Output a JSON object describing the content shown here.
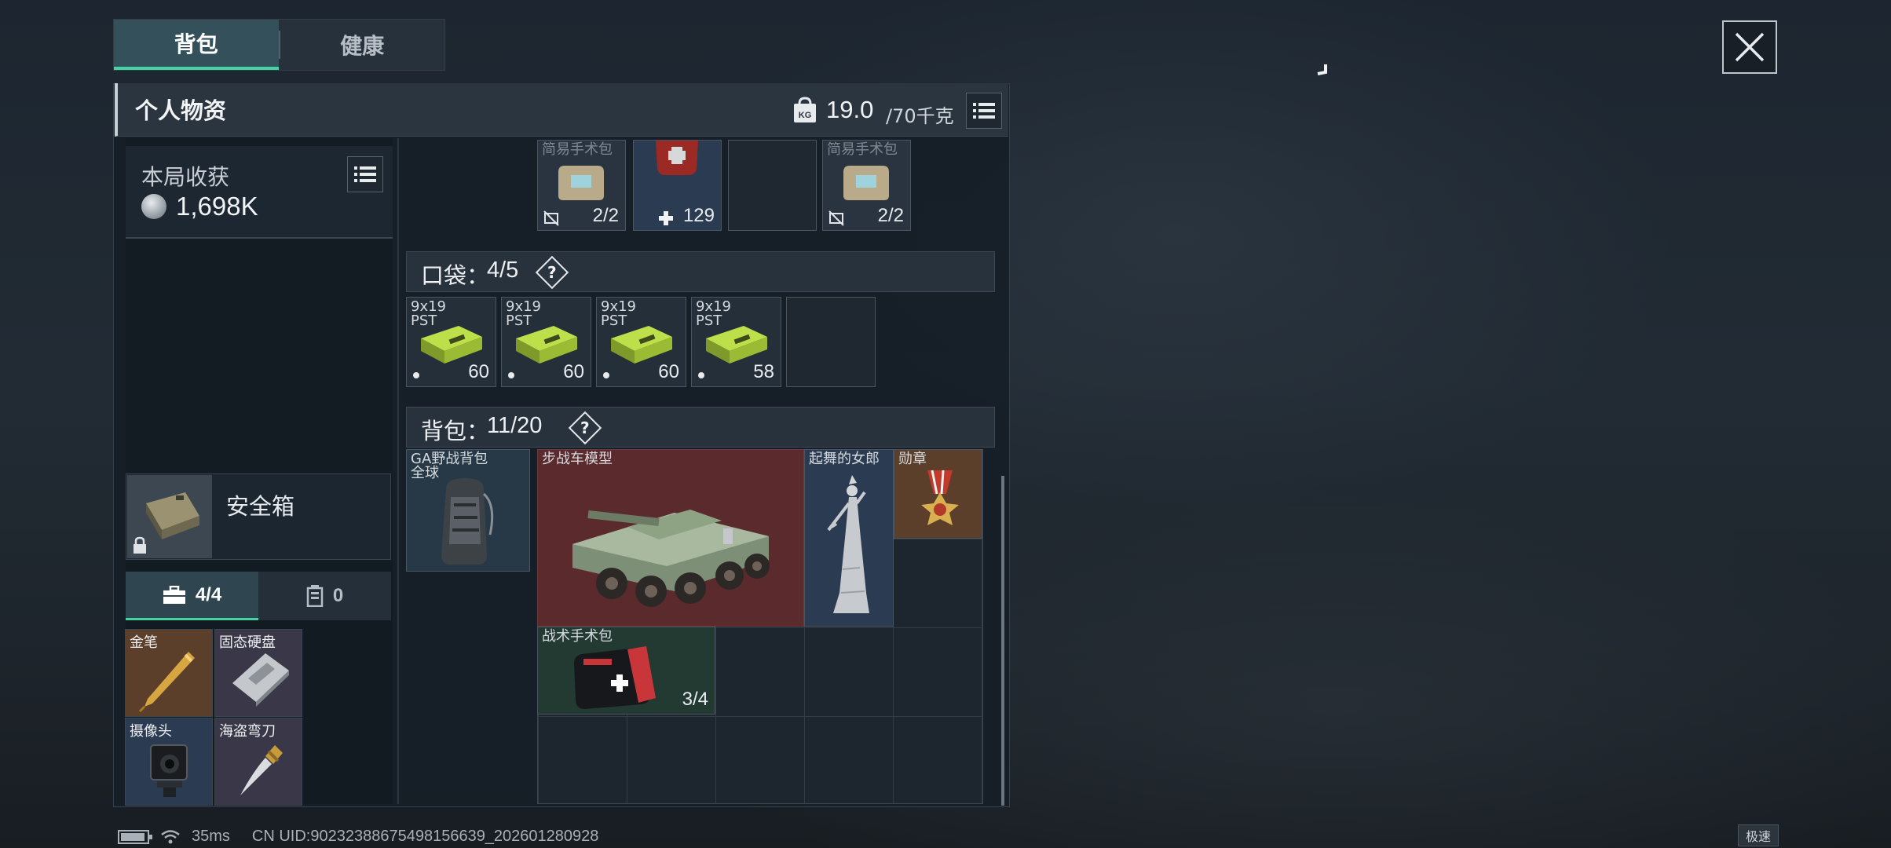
{
  "tabs": [
    {
      "label": "背包",
      "active": true
    },
    {
      "label": "健康",
      "active": false
    }
  ],
  "panel": {
    "title": "个人物资",
    "weight": "19.0",
    "weight_max": "/70千克",
    "weight_icon": "weight-icon",
    "menu_icon": "list-icon"
  },
  "harvest": {
    "label": "本局收获",
    "value": "1,698K",
    "icon": "coin-icon"
  },
  "safebox": {
    "label": "安全箱",
    "icon": "lock-icon"
  },
  "subtabs": [
    {
      "icon": "briefcase-icon",
      "label": "4/4",
      "active": true
    },
    {
      "icon": "canister-icon",
      "label": "0",
      "active": false
    }
  ],
  "case_items": [
    {
      "label": "金笔",
      "color": "#5b3f2a"
    },
    {
      "label": "固态硬盘",
      "color": "#3a3848"
    },
    {
      "label": "摄像头",
      "color": "#2b3b52"
    },
    {
      "label": "海盗弯刀",
      "color": "#3a3848"
    }
  ],
  "top_row": [
    {
      "label": "简易手术包",
      "count": "2/2",
      "icon": "no-repair-icon"
    },
    {
      "label": "",
      "count": "129",
      "icon": "plus-icon"
    },
    {
      "label": "",
      "count": ""
    },
    {
      "label": "简易手术包",
      "count": "2/2",
      "icon": "no-repair-icon"
    }
  ],
  "pocket": {
    "title": "口袋：",
    "count": "4/5",
    "help": "?",
    "items": [
      {
        "label": "9x19\nPST",
        "count": "60"
      },
      {
        "label": "9x19\nPST",
        "count": "60"
      },
      {
        "label": "9x19\nPST",
        "count": "60"
      },
      {
        "label": "9x19\nPST",
        "count": "58"
      }
    ]
  },
  "backpack": {
    "title": "背包：",
    "count": "11/20",
    "help": "?",
    "equipped_label": "GA野战背包\n全球",
    "items": {
      "ifv": {
        "label": "步战车模型",
        "color": "#5a2a2d"
      },
      "dancer": {
        "label": "起舞的女郎",
        "color": "#2b3b52"
      },
      "medal": {
        "label": "勋章",
        "color": "#5b3f2a"
      },
      "medkit": {
        "label": "战术手术包",
        "count": "3/4",
        "color": "#233a33"
      }
    }
  },
  "footer": {
    "ping": "35ms",
    "uid": "CN UID:9023238867549815663​9_202601280928",
    "speed_badge": "极速"
  },
  "colors": {
    "accent": "#46d3a3",
    "red_rarity": "#5a2a2d",
    "gold_rarity": "#5b3f2a",
    "blue_rarity": "#2b3b52",
    "purple_rarity": "#3a3848",
    "green_rarity": "#233a33"
  }
}
